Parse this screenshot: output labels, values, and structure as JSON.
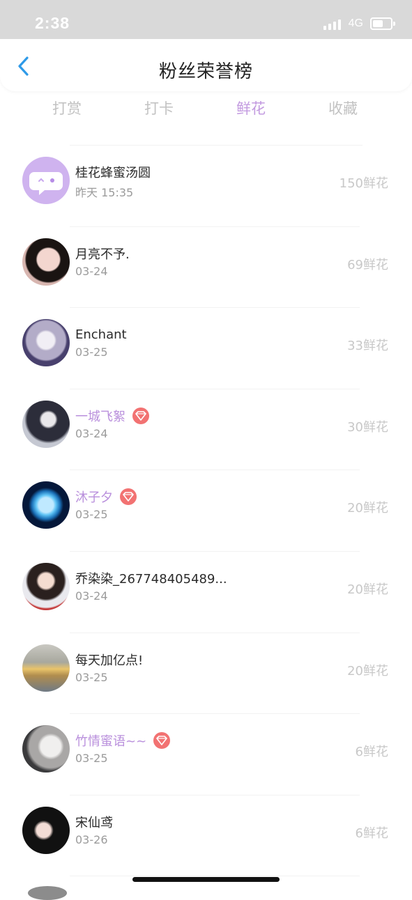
{
  "status_bar": {
    "time": "2:38",
    "network": "4G"
  },
  "header": {
    "title": "粉丝荣誉榜"
  },
  "tabs": [
    {
      "label": "打赏",
      "active": false
    },
    {
      "label": "打卡",
      "active": false
    },
    {
      "label": "鲜花",
      "active": true
    },
    {
      "label": "收藏",
      "active": false
    }
  ],
  "colors": {
    "accent": "#c39be0",
    "vip_name": "#b98fdc",
    "vip_badge": "#f27272"
  },
  "fans": [
    {
      "name": "桂花蜂蜜汤圆",
      "date": "昨天 15:35",
      "amount": "150鲜花",
      "vip": false,
      "avatar": "default-chat-avatar"
    },
    {
      "name": "月亮不予.",
      "date": "03-24",
      "amount": "69鲜花",
      "vip": false,
      "avatar": "user-photo"
    },
    {
      "name": "Enchant",
      "date": "03-25",
      "amount": "33鲜花",
      "vip": false,
      "avatar": "anime-photo"
    },
    {
      "name": "一城飞絮",
      "date": "03-24",
      "amount": "30鲜花",
      "vip": true,
      "avatar": "user-photo"
    },
    {
      "name": "沐子夕",
      "date": "03-25",
      "amount": "20鲜花",
      "vip": true,
      "avatar": "moon-photo"
    },
    {
      "name": "乔染染_267748405489...",
      "date": "03-24",
      "amount": "20鲜花",
      "vip": false,
      "avatar": "user-photo"
    },
    {
      "name": "每天加亿点!",
      "date": "03-25",
      "amount": "20鲜花",
      "vip": false,
      "avatar": "sunset-photo"
    },
    {
      "name": "竹情蜜语~~",
      "date": "03-25",
      "amount": "6鲜花",
      "vip": true,
      "avatar": "user-photo"
    },
    {
      "name": "宋仙鸢",
      "date": "03-26",
      "amount": "6鲜花",
      "vip": false,
      "avatar": "user-photo"
    }
  ]
}
